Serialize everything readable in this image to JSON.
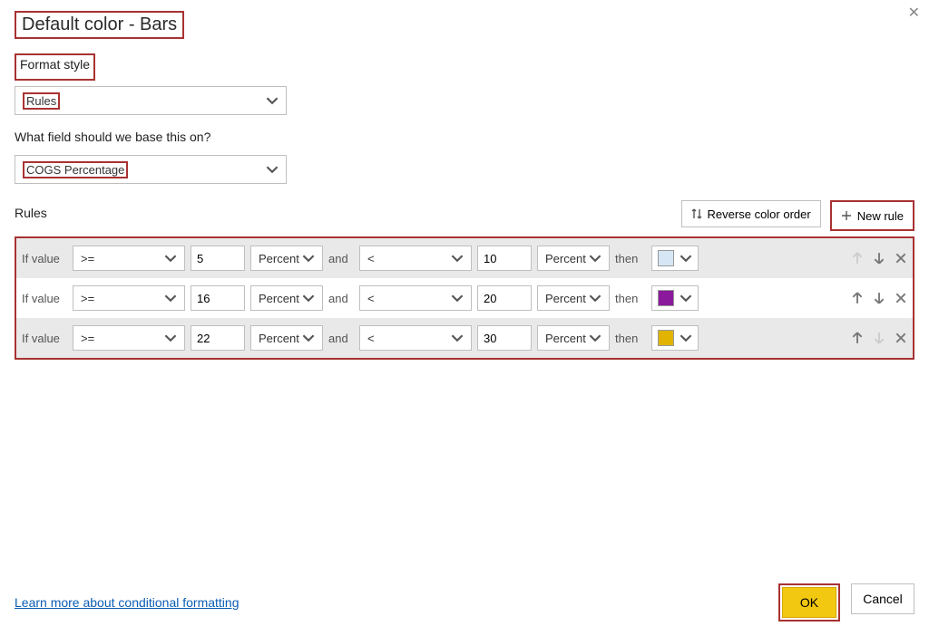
{
  "dialog": {
    "title": "Default color - Bars",
    "formatStyleLabel": "Format style",
    "formatStyleValue": "Rules",
    "fieldQuestion": "What field should we base this on?",
    "fieldValue": "COGS Percentage",
    "rulesLabel": "Rules",
    "reverseLabel": "Reverse color order",
    "newRuleLabel": "New rule",
    "learnMore": "Learn more about conditional formatting",
    "ok": "OK",
    "cancel": "Cancel"
  },
  "ruleText": {
    "if": "If value",
    "and": "and",
    "then": "then"
  },
  "rules": [
    {
      "op1": ">=",
      "val1": "5",
      "unit1": "Percent",
      "op2": "<",
      "val2": "10",
      "unit2": "Percent",
      "color": "#d6e6f4"
    },
    {
      "op1": ">=",
      "val1": "16",
      "unit1": "Percent",
      "op2": "<",
      "val2": "20",
      "unit2": "Percent",
      "color": "#8a1a9b"
    },
    {
      "op1": ">=",
      "val1": "22",
      "unit1": "Percent",
      "op2": "<",
      "val2": "30",
      "unit2": "Percent",
      "color": "#e0b400"
    }
  ]
}
